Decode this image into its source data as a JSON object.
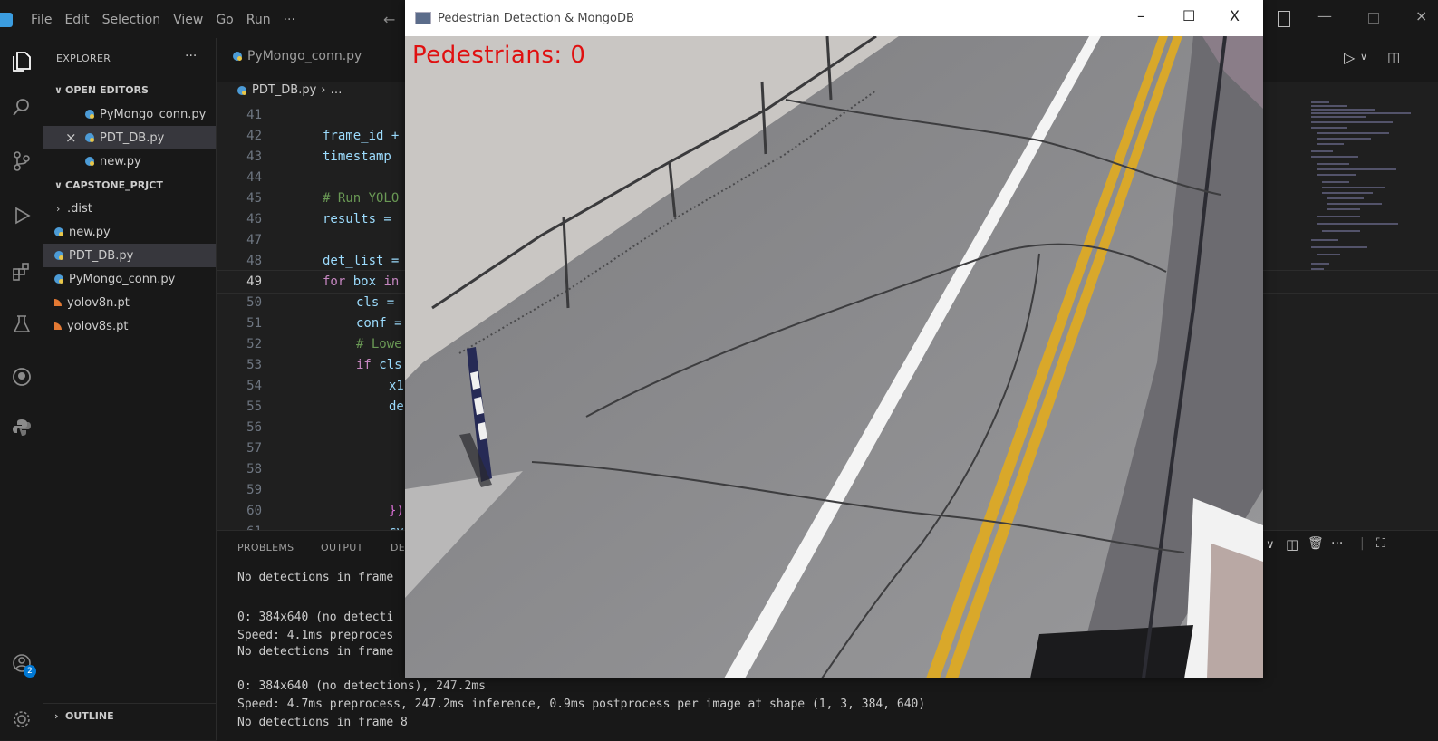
{
  "menu": [
    "File",
    "Edit",
    "Selection",
    "View",
    "Go",
    "Run",
    "···"
  ],
  "explorer": {
    "title": "EXPLORER",
    "dots": "···",
    "open_editors_label": "OPEN EDITORS",
    "open_editors": [
      "PyMongo_conn.py",
      "PDT_DB.py",
      "new.py"
    ],
    "close_glyph": "×",
    "project_label": "CAPSTONE_PRJCT",
    "files": [
      ".dist",
      "new.py",
      "PDT_DB.py",
      "PyMongo_conn.py",
      "yolov8n.pt",
      "yolov8s.pt"
    ],
    "outline_label": "OUTLINE"
  },
  "tabs": {
    "active": "PyMongo_conn.py"
  },
  "breadcrumb": {
    "file": "PDT_DB.py",
    "rest": "…"
  },
  "code": {
    "line_numbers": [
      "41",
      "42",
      "43",
      "44",
      "45",
      "46",
      "47",
      "48",
      "49",
      "50",
      "51",
      "52",
      "53",
      "54",
      "55",
      "56",
      "57",
      "58",
      "59",
      "60",
      "61"
    ],
    "current_line": "49",
    "lines": {
      "l42_a": "frame_id +",
      "l43_a": "timestamp",
      "l45_a": "# Run YOLO",
      "l46_a": "results =",
      "l48_a": "det_list =",
      "l49_kw": "for",
      "l49_var": "box",
      "l49_in": "in",
      "l50_a": "cls =",
      "l51_a": "conf =",
      "l52_a": "# Lowe",
      "l53_kw": "if",
      "l53_var": "cls",
      "l54_a": "x1",
      "l55_a": "de",
      "l60_a": "})",
      "l61_a": "cv"
    }
  },
  "panel": {
    "tabs": [
      "PROBLEMS",
      "OUTPUT",
      "DE"
    ],
    "lines": [
      "No detections in frame",
      "",
      "0: 384x640 (no detecti",
      "Speed: 4.1ms preproces",
      "No detections in frame",
      "",
      "0: 384x640 (no detections), 247.2ms",
      "Speed: 4.7ms preprocess, 247.2ms inference, 0.9ms postprocess per image at shape (1, 3, 384, 640)",
      "No detections in frame 8"
    ]
  },
  "cv_window": {
    "title": "Pedestrian Detection & MongoDB",
    "minimize": "–",
    "maximize": "☐",
    "close": "X",
    "overlay": "Pedestrians: 0"
  },
  "colors": {
    "accent": "#0078d4",
    "overlay_text": "#e01010"
  },
  "badge_count": "2"
}
